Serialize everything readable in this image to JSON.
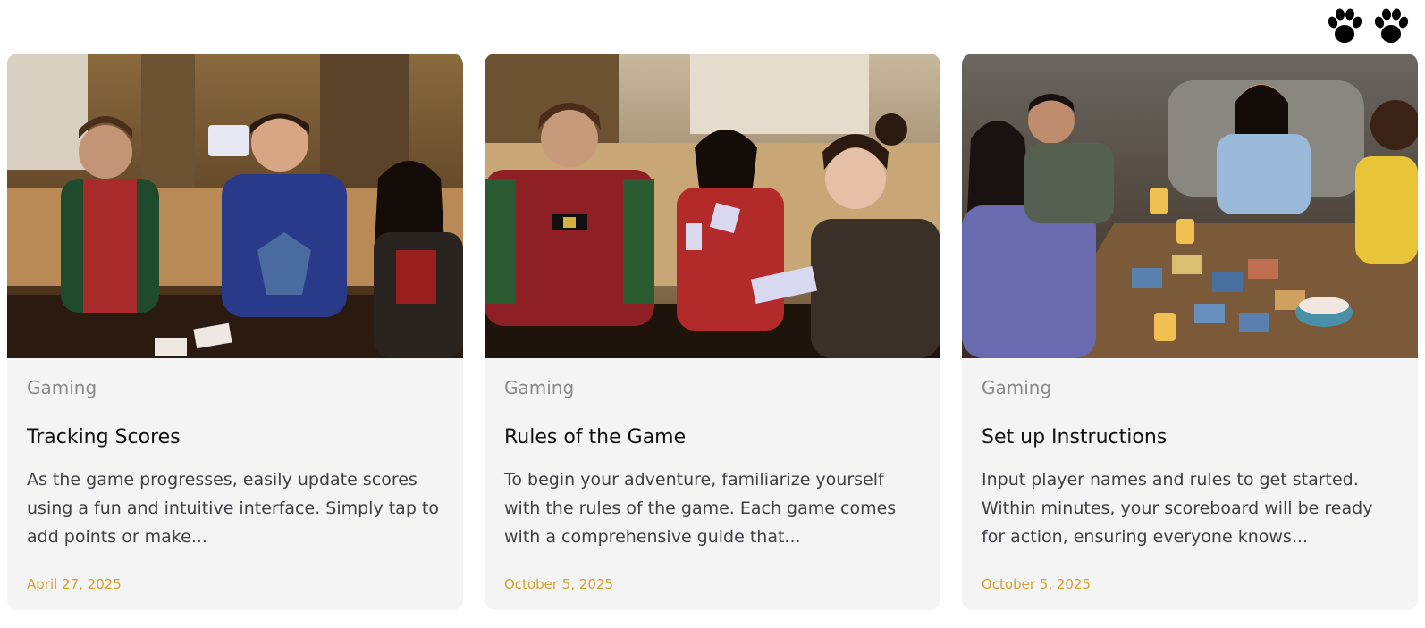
{
  "header": {
    "logo_icon": "paw-prints-icon"
  },
  "cards": [
    {
      "image_alt": "Friends in holiday sweaters playing cards on a couch",
      "category": "Gaming",
      "title": "Tracking Scores",
      "excerpt": "As the game progresses, easily update scores using a fun and intuitive interface. Simply tap to add points or make...",
      "date": "April 27, 2025"
    },
    {
      "image_alt": "Three people in festive outfits holding playing cards",
      "category": "Gaming",
      "title": "Rules of the Game",
      "excerpt": "To begin your adventure, familiarize yourself with the rules of the game. Each game comes with a comprehensive guide that...",
      "date": "October 5, 2025"
    },
    {
      "image_alt": "Group playing a card game around a wooden table",
      "category": "Gaming",
      "title": "Set up Instructions",
      "excerpt": "Input player names and rules to get started. Within minutes, your scoreboard will be ready for action, ensuring everyone knows...",
      "date": "October 5, 2025"
    }
  ],
  "colors": {
    "card_background": "#f4f4f5",
    "date_accent": "#d4a12a",
    "category_text": "#8a8a8a"
  }
}
